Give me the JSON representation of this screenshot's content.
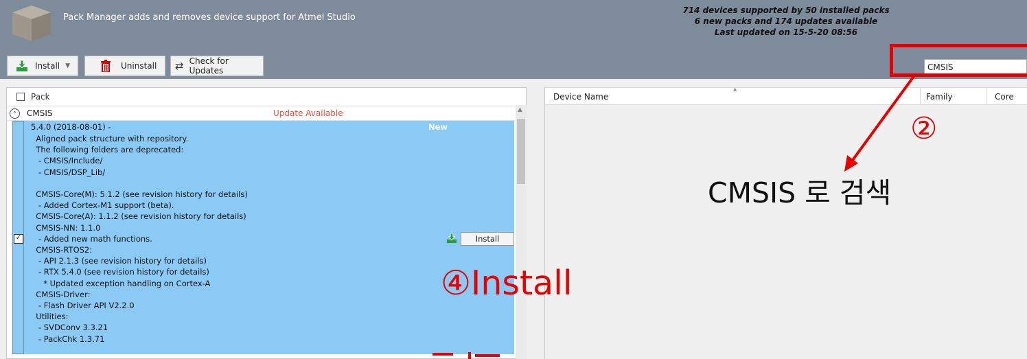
{
  "header": {
    "subtitle": "Pack Manager adds and removes device support for Atmel Studio",
    "stats_line1": "714 devices supported by 50 installed packs",
    "stats_line2": "6 new packs and 174 updates available",
    "stats_line3": "Last updated on 15-5-20 08:56"
  },
  "toolbar": {
    "install_label": "Install",
    "uninstall_label": "Uninstall",
    "check_updates_label": "Check for Updates"
  },
  "search": {
    "value": "CMSIS"
  },
  "packs_table": {
    "header": "Pack",
    "group_name": "CMSIS",
    "group_status": "Update Available",
    "selected_version": {
      "title": "5.4.0 (2018-08-01) -",
      "badge": "New",
      "install_label": "Install",
      "description": "  Aligned pack structure with repository.\n  The following folders are deprecated:\n   - CMSIS/Include/\n   - CMSIS/DSP_Lib/\n\n  CMSIS-Core(M): 5.1.2 (see revision history for details)\n   - Added Cortex-M1 support (beta).\n  CMSIS-Core(A): 1.1.2 (see revision history for details)\n  CMSIS-NN: 1.1.0\n   - Added new math functions.\n  CMSIS-RTOS2:\n   - API 2.1.3 (see revision history for details)\n   - RTX 5.4.0 (see revision history for details)\n     * Updated exception handling on Cortex-A\n  CMSIS-Driver:\n   - Flash Driver API V2.2.0\n  Utilities:\n   - SVDConv 3.3.21\n   - PackChk 1.3.71"
    }
  },
  "device_table": {
    "col_device": "Device Name",
    "col_family": "Family",
    "col_core": "Core"
  },
  "annotations": {
    "circle_2": "②",
    "search_note": "CMSIS 로 검색",
    "install_note": "④Install"
  },
  "colors": {
    "header_bg": "#7e8b9b",
    "selection_bg": "#8ccaf6",
    "annotation_red": "#e60000",
    "status_red": "#e8533a",
    "install_green": "#2e9c3a"
  }
}
